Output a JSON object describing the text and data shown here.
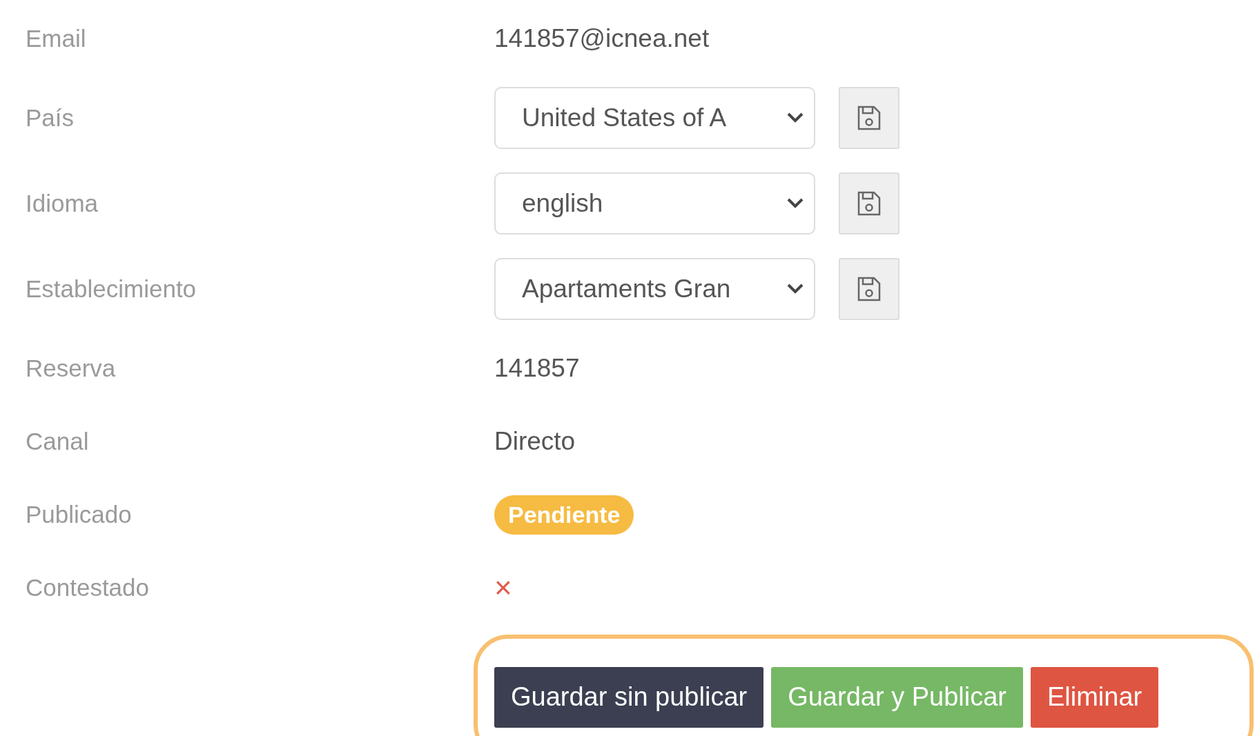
{
  "fields": [
    {
      "label": "Email",
      "kind": "text",
      "value": "141857@icnea.net"
    },
    {
      "label": "País",
      "kind": "select",
      "value": "United States of A"
    },
    {
      "label": "Idioma",
      "kind": "select",
      "value": "english"
    },
    {
      "label": "Establecimiento",
      "kind": "select",
      "value": "Apartaments Gran"
    },
    {
      "label": "Reserva",
      "kind": "text",
      "value": "141857"
    },
    {
      "label": "Canal",
      "kind": "text",
      "value": "Directo"
    },
    {
      "label": "Publicado",
      "kind": "badge",
      "value": "Pendiente",
      "color": "#f6bb42"
    },
    {
      "label": "Contestado",
      "kind": "cross",
      "value": "×"
    }
  ],
  "actions": {
    "highlighted": true,
    "buttons": [
      {
        "label": "Guardar sin publicar",
        "kind": "dark"
      },
      {
        "label": "Guardar y Publicar",
        "kind": "success"
      },
      {
        "label": "Eliminar",
        "kind": "danger"
      }
    ]
  }
}
